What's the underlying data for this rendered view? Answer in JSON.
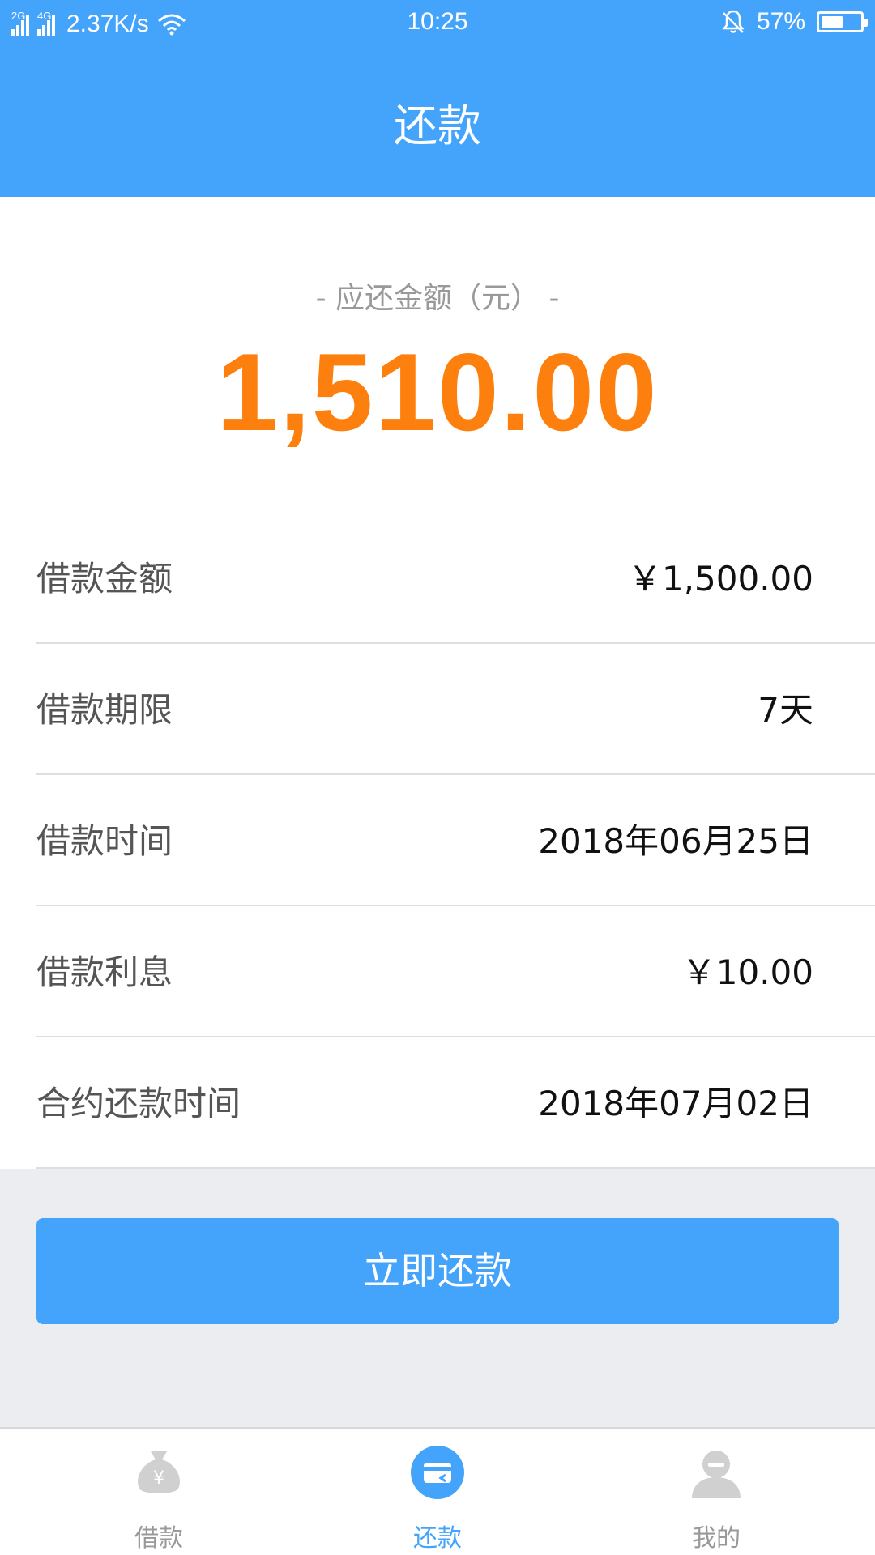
{
  "status_bar": {
    "sim1": "2G",
    "sim2": "4G",
    "net_speed": "2.37K/s",
    "time": "10:25",
    "battery": "57%",
    "battery_level": 0.57
  },
  "header": {
    "title": "还款"
  },
  "summary": {
    "due_label": "- 应还金额（元） -",
    "due_amount": "1,510.00"
  },
  "details": [
    {
      "label": "借款金额",
      "value": "￥1,500.00"
    },
    {
      "label": "借款期限",
      "value": "7天"
    },
    {
      "label": "借款时间",
      "value": "2018年06月25日"
    },
    {
      "label": "借款利息",
      "value": "￥10.00"
    },
    {
      "label": "合约还款时间",
      "value": "2018年07月02日"
    }
  ],
  "actions": {
    "pay_now": "立即还款"
  },
  "bottom_nav": [
    {
      "label": "借款",
      "icon": "money-bag-icon",
      "active": false
    },
    {
      "label": "还款",
      "icon": "repay-card-icon",
      "active": true
    },
    {
      "label": "我的",
      "icon": "user-icon",
      "active": false
    }
  ],
  "colors": {
    "primary": "#44a3fb",
    "amount": "#fd7f0d",
    "inactive_icon": "#d0d0d0"
  }
}
